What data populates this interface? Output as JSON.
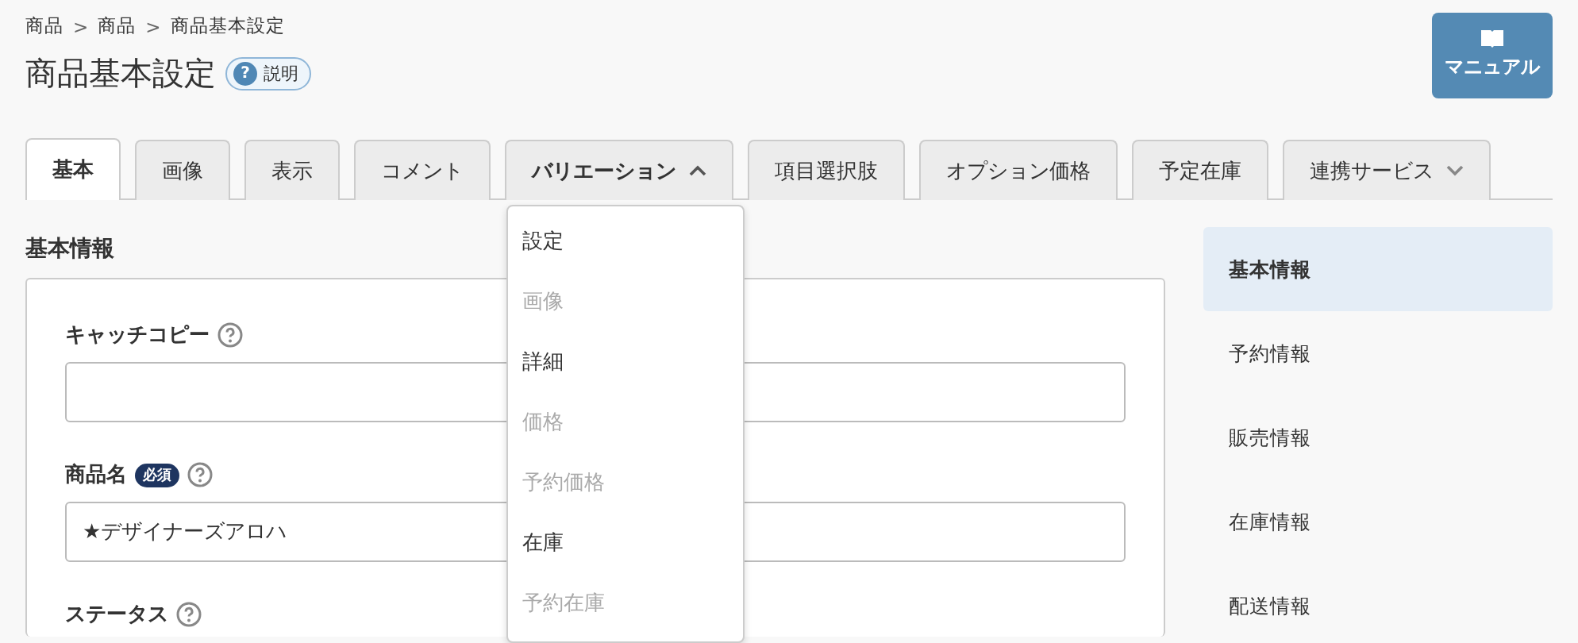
{
  "breadcrumb": [
    {
      "label": "商品"
    },
    {
      "separator": ">",
      "label": "商品"
    },
    {
      "separator": ">",
      "label": "商品基本設定"
    }
  ],
  "page_title": "商品基本設定",
  "help_button": {
    "icon": "?",
    "label": "説明"
  },
  "manual_button": {
    "label": "マニュアル"
  },
  "tabs": [
    {
      "label": "基本",
      "selected": true
    },
    {
      "label": "画像",
      "selected": false
    },
    {
      "label": "表示",
      "selected": false
    },
    {
      "label": "コメント",
      "selected": false
    },
    {
      "label": "バリエーション",
      "selected": false,
      "kind": "menu",
      "expanded": true
    },
    {
      "label": "項目選択肢",
      "selected": false
    },
    {
      "label": "オプション価格",
      "selected": false
    },
    {
      "label": "予定在庫",
      "selected": false
    },
    {
      "label": "連携サービス",
      "selected": false,
      "kind": "menu",
      "expanded": false
    }
  ],
  "dropdown_items": [
    {
      "label": "設定",
      "disabled": false
    },
    {
      "label": "画像",
      "disabled": true
    },
    {
      "label": "詳細",
      "disabled": false
    },
    {
      "label": "価格",
      "disabled": true
    },
    {
      "label": "予約価格",
      "disabled": true
    },
    {
      "label": "在庫",
      "disabled": false
    },
    {
      "label": "予約在庫",
      "disabled": true
    }
  ],
  "section_title": "基本情報",
  "fields": [
    {
      "label": "キャッチコピー",
      "required": false,
      "kind": "text"
    },
    {
      "label": "商品名",
      "required": true,
      "required_label": "必須",
      "kind": "text",
      "value": "★デザイナーズアロハ"
    },
    {
      "label": "ステータス",
      "required": false,
      "kind": "heading"
    }
  ],
  "side_nav": [
    {
      "label": "基本情報",
      "selected": true
    },
    {
      "label": "予約情報",
      "selected": false
    },
    {
      "label": "販売情報",
      "selected": false
    },
    {
      "label": "在庫情報",
      "selected": false
    },
    {
      "label": "配送情報",
      "selected": false
    }
  ]
}
